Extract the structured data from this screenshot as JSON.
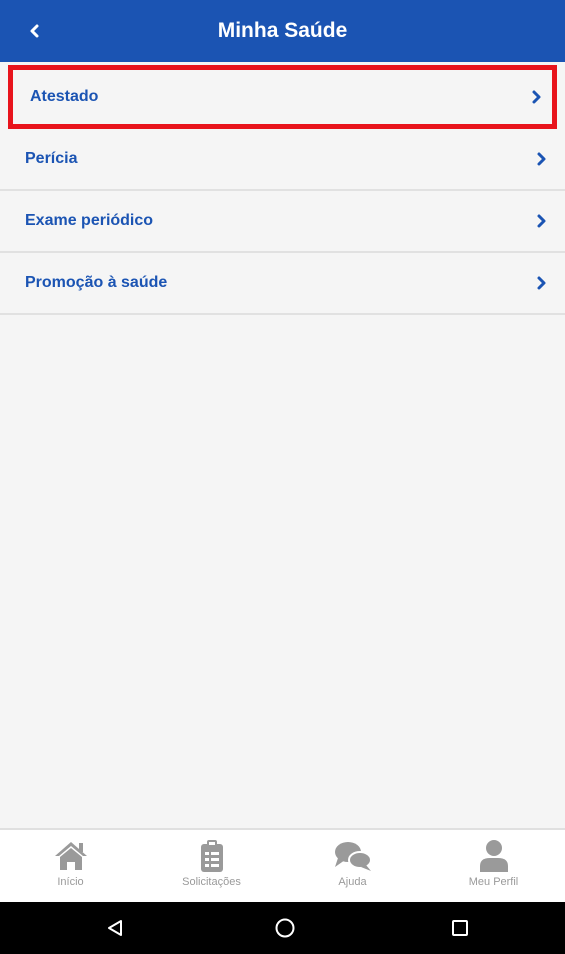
{
  "header": {
    "title": "Minha Saúde",
    "back_icon": "chevron-left-icon"
  },
  "menu": {
    "items": [
      {
        "label": "Atestado",
        "highlighted": true
      },
      {
        "label": "Perícia"
      },
      {
        "label": "Exame periódico"
      },
      {
        "label": "Promoção à saúde"
      }
    ]
  },
  "bottom_nav": {
    "items": [
      {
        "label": "Início",
        "icon": "home-icon"
      },
      {
        "label": "Solicitações",
        "icon": "clipboard-icon"
      },
      {
        "label": "Ajuda",
        "icon": "chat-bubbles-icon"
      },
      {
        "label": "Meu Perfil",
        "icon": "user-icon"
      }
    ]
  },
  "system_nav": {
    "buttons": [
      "back-triangle-icon",
      "home-circle-icon",
      "recents-square-icon"
    ]
  },
  "colors": {
    "primary": "#1b54b3",
    "highlight_border": "#e8141c",
    "background": "#f5f5f5"
  }
}
